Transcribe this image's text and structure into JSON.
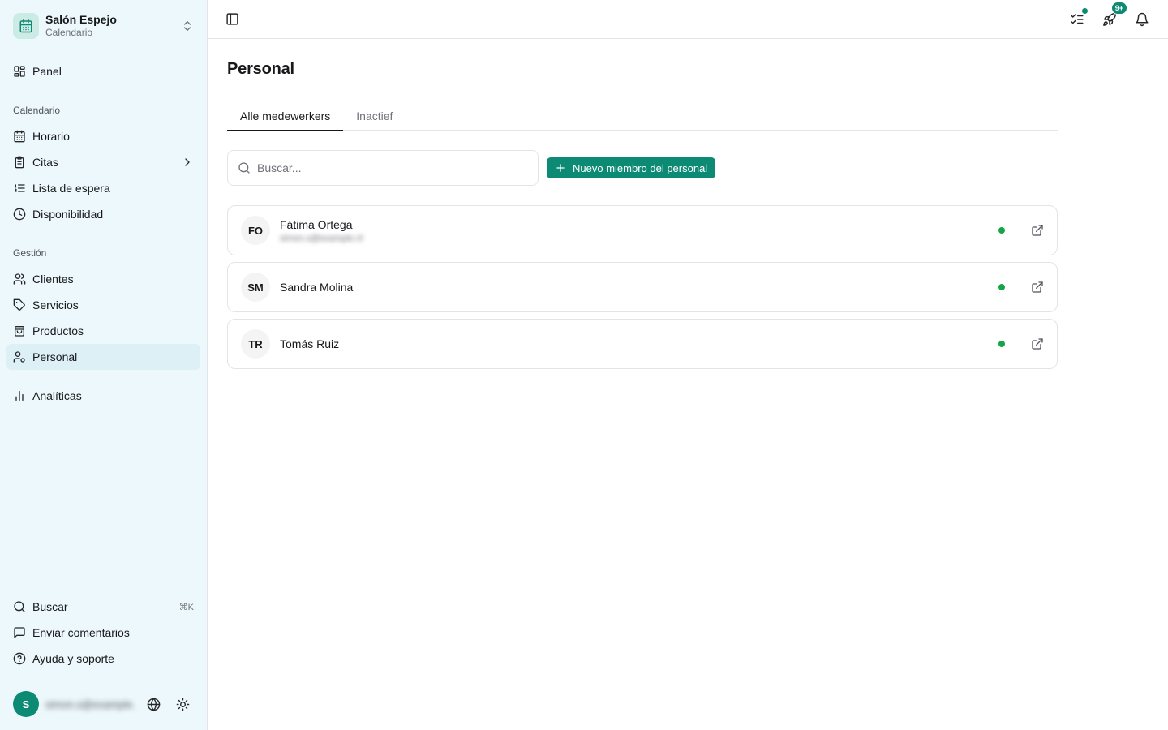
{
  "org": {
    "name": "Salón Espejo",
    "subtitle": "Calendario"
  },
  "nav": {
    "panel": "Panel",
    "calendar_group": "Calendario",
    "calendar_items": [
      "Horario",
      "Citas",
      "Lista de espera",
      "Disponibilidad"
    ],
    "management_group": "Gestión",
    "management_items": [
      "Clientes",
      "Servicios",
      "Productos",
      "Personal"
    ],
    "analytics": "Analíticas",
    "active_item": "Personal"
  },
  "footer": {
    "search": "Buscar",
    "search_shortcut": "⌘K",
    "feedback": "Enviar comentarios",
    "help": "Ayuda y soporte"
  },
  "user": {
    "initial": "S",
    "email": "simon.s@example.com"
  },
  "topbar": {
    "notifications_badge": "9+"
  },
  "page": {
    "title": "Personal",
    "tabs": [
      "Alle medewerkers",
      "Inactief"
    ],
    "active_tab": "Alle medewerkers",
    "search_placeholder": "Buscar...",
    "new_staff_button": "Nuevo miembro del personal"
  },
  "staff": [
    {
      "initials": "FO",
      "name": "Fátima Ortega",
      "email": "simon.s@example.nl",
      "status": "active"
    },
    {
      "initials": "SM",
      "name": "Sandra Molina",
      "email": "",
      "status": "active"
    },
    {
      "initials": "TR",
      "name": "Tomás Ruiz",
      "email": "",
      "status": "active"
    }
  ],
  "colors": {
    "accent": "#0d8a74",
    "sidebar_bg": "#ecf8fb",
    "status_active": "#16a34a"
  }
}
